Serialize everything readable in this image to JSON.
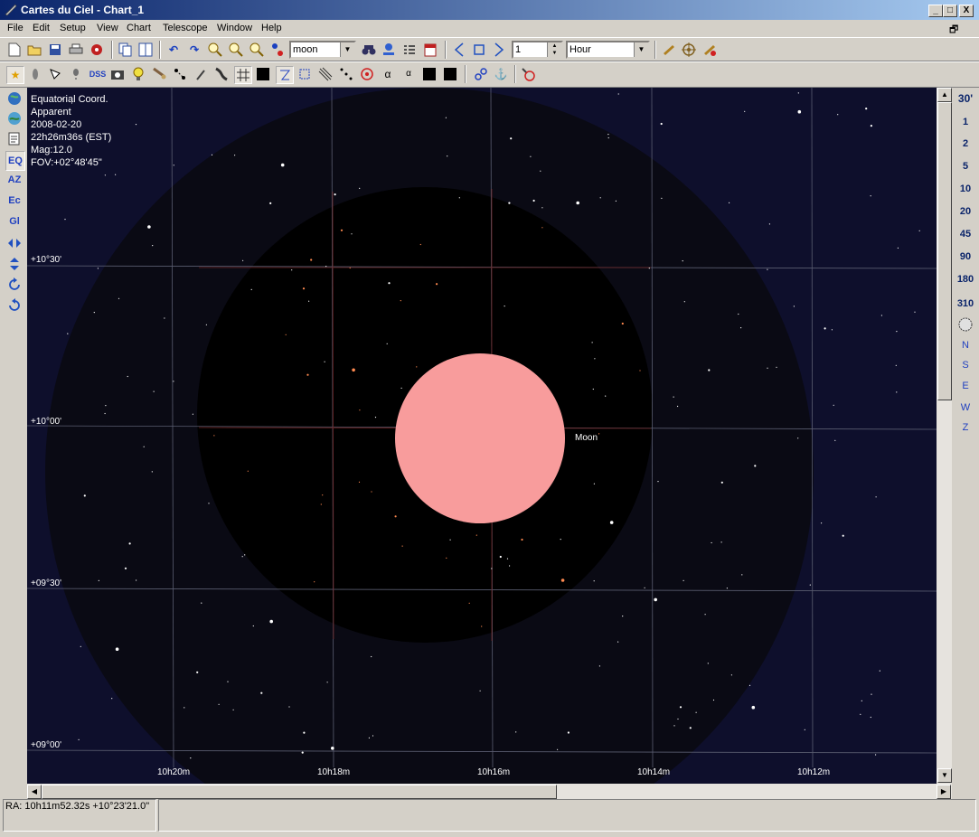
{
  "window": {
    "title": "Cartes du Ciel - Chart_1",
    "controls": [
      "_",
      "□",
      "X"
    ]
  },
  "menu": [
    "File",
    "Edit",
    "Setup",
    "View",
    "Chart",
    "Telescope",
    "Window",
    "Help"
  ],
  "toolbar1": {
    "search_value": "moon",
    "step_value": "1",
    "step_unit": "Hour"
  },
  "toolbar2": {
    "dss_label": "DSS",
    "alpha_label": "α",
    "alpha2_label": "α"
  },
  "lefttb": {
    "eq_label": "EQ",
    "az_label": "AZ",
    "ec_label": "Ec",
    "gl_label": "Gl"
  },
  "chart_info": {
    "coord": "Equatorial Coord.",
    "mode": "Apparent",
    "date": "2008-02-20",
    "time": "22h26m36s (EST)",
    "mag": "Mag:12.0",
    "fov": "FOV:+02°48'45\""
  },
  "dec_labels": [
    "+10°30'",
    "+10°00'",
    "+09°30'",
    "+09°00'"
  ],
  "ra_labels": [
    "10h20m",
    "10h18m",
    "10h16m",
    "10h14m",
    "10h12m"
  ],
  "moon_label": "Moon",
  "zoom_levels": [
    "30'",
    "1",
    "2",
    "5",
    "10",
    "20",
    "45",
    "90",
    "180",
    "310"
  ],
  "directions": [
    "N",
    "S",
    "E",
    "W",
    "Z"
  ],
  "status": {
    "coords": "RA: 10h11m52.32s +10°23'21.0\""
  },
  "colors": {
    "sky": "#0e0f2c",
    "moon": "#f89c9c",
    "grid": "#55586a",
    "grid_red": "#6a1f1f"
  }
}
